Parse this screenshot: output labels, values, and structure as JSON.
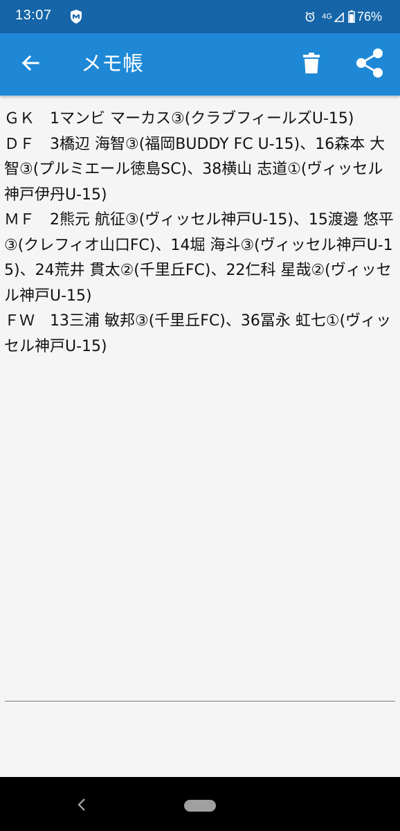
{
  "status_bar": {
    "time": "13:07",
    "network": "4G",
    "battery_percent": "76%",
    "icons": [
      "shield-icon",
      "alarm-icon",
      "signal-icon",
      "battery-icon"
    ]
  },
  "app_bar": {
    "title": "メモ帳",
    "background_color": "#1e88d6",
    "icons": [
      "back-arrow-icon",
      "trash-icon",
      "share-icon"
    ]
  },
  "memo": {
    "text": "ＧＫ　1マンビ マーカス③(クラブフィールズU-15)\nＤＦ　3橋辺 海智③(福岡BUDDY FC U-15)、16森本 大智③(プルミエール徳島SC)、38横山 志道①(ヴィッセル神戸伊丹U-15)\nＭＦ　2熊元 航征③(ヴィッセル神戸U-15)、15渡邊 悠平③(クレフィオ山口FC)、14堀 海斗③(ヴィッセル神戸U-15)、24荒井 貫太②(千里丘FC)、22仁科 星哉②(ヴィッセル神戸U-15)\nＦＷ　13三浦 敏邦③(千里丘FC)、36冨永 虹七①(ヴィッセル神戸U-15)"
  },
  "nav_bar": {
    "icons": [
      "nav-back-icon",
      "home-pill-icon"
    ]
  }
}
